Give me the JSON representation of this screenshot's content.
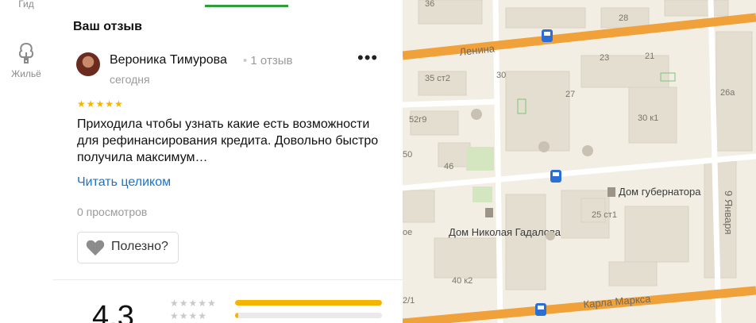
{
  "rail": {
    "guide_label": "Гид",
    "housing_label": "Жильё"
  },
  "review": {
    "section_title": "Ваш отзыв",
    "author": "Вероника Тимурова",
    "review_count": "1 отзыв",
    "date": "сегодня",
    "more_label": "•••",
    "stars": "★★★★★",
    "rating": 5,
    "text": "Приходила чтобы узнать какие есть возможности для рефинансирования кредита. Довольно быстро получила максимум…",
    "read_more": "Читать целиком",
    "views": "0 просмотров",
    "useful_label": "Полезно?"
  },
  "summary": {
    "rating": "4,3",
    "distribution": [
      {
        "stars": "★★★★★",
        "fraction": 1.0
      },
      {
        "stars": "★★★★",
        "fraction": 0.02
      }
    ]
  },
  "map": {
    "streets": [
      "Ленина",
      "Карла Маркса",
      "9 Января"
    ],
    "landmarks": [
      "Дом губернатора",
      "Дом Николая Гадалова"
    ],
    "buildings": [
      "36",
      "28",
      "23",
      "21",
      "26а",
      "35 ст2",
      "30",
      "27",
      "52г9",
      "30 к1",
      "50",
      "46",
      "25 ст1",
      "40 к2",
      "2/1",
      "ое"
    ],
    "colors": {
      "major_road": "#f0a13a",
      "minor_road": "#ffffff",
      "building": "#e3ddd0",
      "park": "#cfe3b8",
      "bus_stop": "#2b6fd6"
    }
  }
}
